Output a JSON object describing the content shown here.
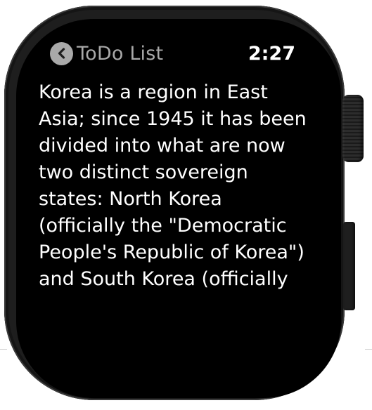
{
  "app": {
    "back_label": "ToDo List",
    "back_icon": "chevron-left-icon",
    "time": "2:27"
  },
  "content": {
    "text": "Korea is a region in East Asia; since 1945 it has been divided into what are now two distinct sovereign states: North Korea (officially the \"Democratic People's Republic of Korea\") and South Korea (officially"
  },
  "colors": {
    "screen_background": "#000000",
    "back_button": "#a9a9a9",
    "text": "#ffffff",
    "watch_case": "#1e1e1e"
  }
}
